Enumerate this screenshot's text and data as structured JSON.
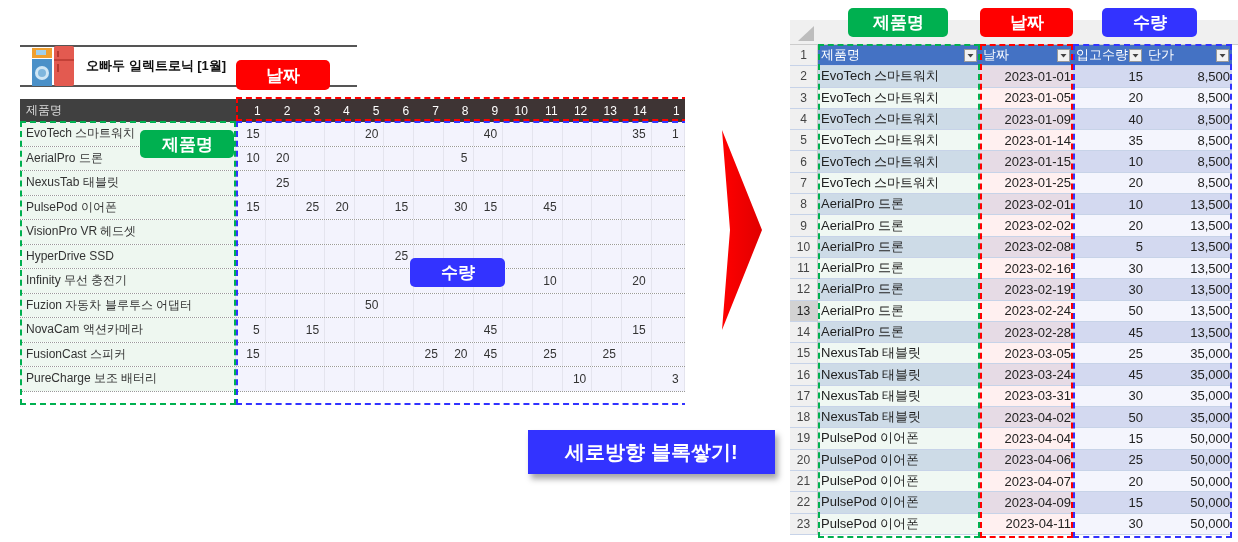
{
  "left_sheet": {
    "title": "오빠두 일렉트로닉 [1월]",
    "header": {
      "name": "제품명",
      "days": [
        "1",
        "2",
        "3",
        "4",
        "5",
        "6",
        "7",
        "8",
        "9",
        "10",
        "11",
        "12",
        "13",
        "14",
        "1"
      ]
    },
    "rows": [
      {
        "name": "EvoTech 스마트워치",
        "cells": [
          {
            "kind": "number",
            "text": "15"
          },
          {
            "kind": "blank"
          },
          {
            "kind": "blank"
          },
          {
            "kind": "blank"
          },
          {
            "kind": "number",
            "text": "20"
          },
          {
            "kind": "blank"
          },
          {
            "kind": "blank"
          },
          {
            "kind": "blank"
          },
          {
            "kind": "number",
            "text": "40"
          },
          {
            "kind": "blank"
          },
          {
            "kind": "blank"
          },
          {
            "kind": "blank"
          },
          {
            "kind": "blank"
          },
          {
            "kind": "number",
            "text": "35"
          },
          {
            "kind": "number",
            "text": "1"
          }
        ]
      },
      {
        "name": "AerialPro 드론",
        "cells": [
          {
            "kind": "number",
            "text": "10"
          },
          {
            "kind": "number",
            "text": "20"
          },
          {
            "kind": "blank"
          },
          {
            "kind": "blank"
          },
          {
            "kind": "blank"
          },
          {
            "kind": "blank"
          },
          {
            "kind": "blank"
          },
          {
            "kind": "number",
            "text": "5"
          },
          {
            "kind": "blank"
          },
          {
            "kind": "blank"
          },
          {
            "kind": "blank"
          },
          {
            "kind": "blank"
          },
          {
            "kind": "blank"
          },
          {
            "kind": "blank"
          },
          {
            "kind": "blank"
          }
        ]
      },
      {
        "name": "NexusTab 태블릿",
        "cells": [
          {
            "kind": "blank"
          },
          {
            "kind": "number",
            "text": "25"
          },
          {
            "kind": "blank"
          },
          {
            "kind": "blank"
          },
          {
            "kind": "blank"
          },
          {
            "kind": "blank"
          },
          {
            "kind": "blank"
          },
          {
            "kind": "blank"
          },
          {
            "kind": "blank"
          },
          {
            "kind": "blank"
          },
          {
            "kind": "blank"
          },
          {
            "kind": "blank"
          },
          {
            "kind": "blank"
          },
          {
            "kind": "blank"
          },
          {
            "kind": "blank"
          }
        ]
      },
      {
        "name": "PulsePod 이어폰",
        "cells": [
          {
            "kind": "number",
            "text": "15"
          },
          {
            "kind": "blank"
          },
          {
            "kind": "number",
            "text": "25"
          },
          {
            "kind": "number",
            "text": "20"
          },
          {
            "kind": "blank"
          },
          {
            "kind": "number",
            "text": "15"
          },
          {
            "kind": "blank"
          },
          {
            "kind": "number",
            "text": "30"
          },
          {
            "kind": "number",
            "text": "15"
          },
          {
            "kind": "blank"
          },
          {
            "kind": "number",
            "text": "45"
          },
          {
            "kind": "blank"
          },
          {
            "kind": "blank"
          },
          {
            "kind": "blank"
          },
          {
            "kind": "blank"
          }
        ]
      },
      {
        "name": "VisionPro VR 헤드셋",
        "cells": [
          {
            "kind": "blank"
          },
          {
            "kind": "blank"
          },
          {
            "kind": "blank"
          },
          {
            "kind": "blank"
          },
          {
            "kind": "blank"
          },
          {
            "kind": "blank"
          },
          {
            "kind": "blank"
          },
          {
            "kind": "blank"
          },
          {
            "kind": "blank"
          },
          {
            "kind": "blank"
          },
          {
            "kind": "blank"
          },
          {
            "kind": "blank"
          },
          {
            "kind": "blank"
          },
          {
            "kind": "blank"
          },
          {
            "kind": "blank"
          }
        ]
      },
      {
        "name": "HyperDrive SSD",
        "cells": [
          {
            "kind": "blank"
          },
          {
            "kind": "blank"
          },
          {
            "kind": "blank"
          },
          {
            "kind": "blank"
          },
          {
            "kind": "blank"
          },
          {
            "kind": "number",
            "text": "25"
          },
          {
            "kind": "blank"
          },
          {
            "kind": "blank"
          },
          {
            "kind": "blank"
          },
          {
            "kind": "blank"
          },
          {
            "kind": "blank"
          },
          {
            "kind": "blank"
          },
          {
            "kind": "blank"
          },
          {
            "kind": "blank"
          },
          {
            "kind": "blank"
          }
        ]
      },
      {
        "name": "Infinity 무선 충전기",
        "cells": [
          {
            "kind": "blank"
          },
          {
            "kind": "blank"
          },
          {
            "kind": "blank"
          },
          {
            "kind": "blank"
          },
          {
            "kind": "blank"
          },
          {
            "kind": "blank"
          },
          {
            "kind": "blank"
          },
          {
            "kind": "blank"
          },
          {
            "kind": "blank"
          },
          {
            "kind": "blank"
          },
          {
            "kind": "number",
            "text": "10"
          },
          {
            "kind": "blank"
          },
          {
            "kind": "blank"
          },
          {
            "kind": "number",
            "text": "20"
          },
          {
            "kind": "blank"
          }
        ]
      },
      {
        "name": "Fuzion 자동차 블루투스 어댑터",
        "cells": [
          {
            "kind": "blank"
          },
          {
            "kind": "blank"
          },
          {
            "kind": "blank"
          },
          {
            "kind": "blank"
          },
          {
            "kind": "number",
            "text": "50"
          },
          {
            "kind": "blank"
          },
          {
            "kind": "blank"
          },
          {
            "kind": "blank"
          },
          {
            "kind": "blank"
          },
          {
            "kind": "blank"
          },
          {
            "kind": "blank"
          },
          {
            "kind": "blank"
          },
          {
            "kind": "blank"
          },
          {
            "kind": "blank"
          },
          {
            "kind": "blank"
          }
        ]
      },
      {
        "name": "NovaCam 액션카메라",
        "cells": [
          {
            "kind": "number",
            "text": "5"
          },
          {
            "kind": "blank"
          },
          {
            "kind": "number",
            "text": "15"
          },
          {
            "kind": "blank"
          },
          {
            "kind": "blank"
          },
          {
            "kind": "blank"
          },
          {
            "kind": "blank"
          },
          {
            "kind": "blank"
          },
          {
            "kind": "number",
            "text": "45"
          },
          {
            "kind": "blank"
          },
          {
            "kind": "blank"
          },
          {
            "kind": "blank"
          },
          {
            "kind": "blank"
          },
          {
            "kind": "number",
            "text": "15"
          },
          {
            "kind": "blank"
          }
        ]
      },
      {
        "name": "FusionCast 스피커",
        "cells": [
          {
            "kind": "number",
            "text": "15"
          },
          {
            "kind": "blank"
          },
          {
            "kind": "blank"
          },
          {
            "kind": "blank"
          },
          {
            "kind": "blank"
          },
          {
            "kind": "blank"
          },
          {
            "kind": "number",
            "text": "25"
          },
          {
            "kind": "number",
            "text": "20"
          },
          {
            "kind": "number",
            "text": "45"
          },
          {
            "kind": "blank"
          },
          {
            "kind": "number",
            "text": "25"
          },
          {
            "kind": "blank"
          },
          {
            "kind": "number",
            "text": "25"
          },
          {
            "kind": "blank"
          },
          {
            "kind": "blank"
          }
        ]
      },
      {
        "name": "PureCharge 보조 배터리",
        "cells": [
          {
            "kind": "blank"
          },
          {
            "kind": "blank"
          },
          {
            "kind": "blank"
          },
          {
            "kind": "blank"
          },
          {
            "kind": "blank"
          },
          {
            "kind": "blank"
          },
          {
            "kind": "blank"
          },
          {
            "kind": "blank"
          },
          {
            "kind": "blank"
          },
          {
            "kind": "blank"
          },
          {
            "kind": "blank"
          },
          {
            "kind": "number",
            "text": "10"
          },
          {
            "kind": "blank"
          },
          {
            "kind": "blank"
          },
          {
            "kind": "number",
            "text": "3"
          }
        ]
      }
    ],
    "tags": [
      {
        "kind": "day_header",
        "text": "날짜",
        "color": "#ff0000"
      },
      {
        "kind": "name_column",
        "text": "제품명",
        "color": "#00b050"
      },
      {
        "kind": "quantity_area",
        "text": "수량",
        "color": "#3333ff"
      }
    ]
  },
  "callout": {
    "text": "세로방향 블록쌓기!"
  },
  "right_sheet": {
    "tags": [
      {
        "kind": "name_column",
        "text": "제품명",
        "color": "#00b050"
      },
      {
        "kind": "date_column",
        "text": "날짜",
        "color": "#ff0000"
      },
      {
        "kind": "quantity_area",
        "text": "수량",
        "color": "#3333ff"
      }
    ],
    "header_row_number": "1",
    "columns": [
      "제품명",
      "날짜",
      "입고수량",
      "단가"
    ],
    "rows": [
      {
        "number": "2",
        "product": "EvoTech 스마트워치",
        "date": "2023-01-01",
        "quantity": "15",
        "price": "8,500",
        "selected": false
      },
      {
        "number": "3",
        "product": "EvoTech 스마트워치",
        "date": "2023-01-05",
        "quantity": "20",
        "price": "8,500",
        "selected": false
      },
      {
        "number": "4",
        "product": "EvoTech 스마트워치",
        "date": "2023-01-09",
        "quantity": "40",
        "price": "8,500",
        "selected": false
      },
      {
        "number": "5",
        "product": "EvoTech 스마트워치",
        "date": "2023-01-14",
        "quantity": "35",
        "price": "8,500",
        "selected": false
      },
      {
        "number": "6",
        "product": "EvoTech 스마트워치",
        "date": "2023-01-15",
        "quantity": "10",
        "price": "8,500",
        "selected": false
      },
      {
        "number": "7",
        "product": "EvoTech 스마트워치",
        "date": "2023-01-25",
        "quantity": "20",
        "price": "8,500",
        "selected": false
      },
      {
        "number": "8",
        "product": "AerialPro 드론",
        "date": "2023-02-01",
        "quantity": "10",
        "price": "13,500",
        "selected": false
      },
      {
        "number": "9",
        "product": "AerialPro 드론",
        "date": "2023-02-02",
        "quantity": "20",
        "price": "13,500",
        "selected": false
      },
      {
        "number": "10",
        "product": "AerialPro 드론",
        "date": "2023-02-08",
        "quantity": "5",
        "price": "13,500",
        "selected": false
      },
      {
        "number": "11",
        "product": "AerialPro 드론",
        "date": "2023-02-16",
        "quantity": "30",
        "price": "13,500",
        "selected": false
      },
      {
        "number": "12",
        "product": "AerialPro 드론",
        "date": "2023-02-19",
        "quantity": "30",
        "price": "13,500",
        "selected": false
      },
      {
        "number": "13",
        "product": "AerialPro 드론",
        "date": "2023-02-24",
        "quantity": "50",
        "price": "13,500",
        "selected": true
      },
      {
        "number": "14",
        "product": "AerialPro 드론",
        "date": "2023-02-28",
        "quantity": "45",
        "price": "13,500",
        "selected": false
      },
      {
        "number": "15",
        "product": "NexusTab 태블릿",
        "date": "2023-03-05",
        "quantity": "25",
        "price": "35,000",
        "selected": false
      },
      {
        "number": "16",
        "product": "NexusTab 태블릿",
        "date": "2023-03-24",
        "quantity": "45",
        "price": "35,000",
        "selected": false
      },
      {
        "number": "17",
        "product": "NexusTab 태블릿",
        "date": "2023-03-31",
        "quantity": "30",
        "price": "35,000",
        "selected": false
      },
      {
        "number": "18",
        "product": "NexusTab 태블릿",
        "date": "2023-04-02",
        "quantity": "50",
        "price": "35,000",
        "selected": false
      },
      {
        "number": "19",
        "product": "PulsePod 이어폰",
        "date": "2023-04-04",
        "quantity": "15",
        "price": "50,000",
        "selected": false
      },
      {
        "number": "20",
        "product": "PulsePod 이어폰",
        "date": "2023-04-06",
        "quantity": "25",
        "price": "50,000",
        "selected": false
      },
      {
        "number": "21",
        "product": "PulsePod 이어폰",
        "date": "2023-04-07",
        "quantity": "20",
        "price": "50,000",
        "selected": false
      },
      {
        "number": "22",
        "product": "PulsePod 이어폰",
        "date": "2023-04-09",
        "quantity": "15",
        "price": "50,000",
        "selected": false
      },
      {
        "number": "23",
        "product": "PulsePod 이어폰",
        "date": "2023-04-11",
        "quantity": "30",
        "price": "50,000",
        "selected": false
      }
    ]
  }
}
